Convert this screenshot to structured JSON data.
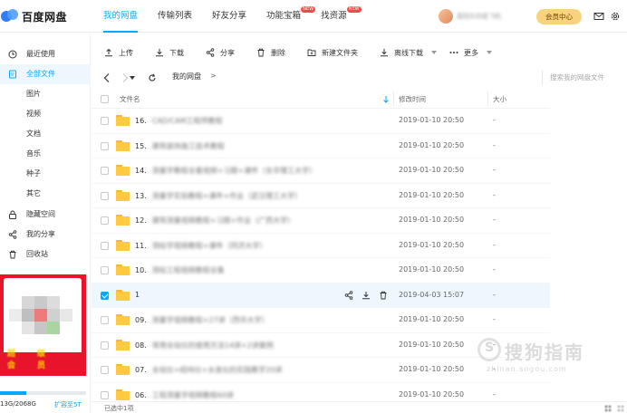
{
  "app": {
    "logo_text": "百度网盘"
  },
  "nav": [
    {
      "label": "我的网盘",
      "active": true,
      "badge": ""
    },
    {
      "label": "传输列表",
      "active": false,
      "badge": ""
    },
    {
      "label": "好友分享",
      "active": false,
      "badge": ""
    },
    {
      "label": "功能宝箱",
      "active": false,
      "badge": "NEW"
    },
    {
      "label": "找资源",
      "active": false,
      "badge": "NEW"
    }
  ],
  "user": {
    "name": "莫回头的纸飞机",
    "vip_label": "会员中心"
  },
  "sidebar": {
    "items": [
      {
        "label": "最近使用",
        "icon": "clock-icon"
      },
      {
        "label": "全部文件",
        "icon": "file-icon",
        "active": true
      },
      {
        "label": "隐藏空间",
        "icon": "lock-icon"
      },
      {
        "label": "我的分享",
        "icon": "share-icon"
      },
      {
        "label": "回收站",
        "icon": "trash-icon"
      }
    ],
    "sub_items": [
      "图片",
      "视频",
      "文档",
      "音乐",
      "种子",
      "其它"
    ],
    "promo_text": "超级会员",
    "quota_text": "13G/2068G",
    "quota_fraction": 0.31,
    "expand_label": "扩容至5T"
  },
  "toolbar": {
    "upload": "上传",
    "download": "下载",
    "share": "分享",
    "delete": "删除",
    "new_folder": "新建文件夹",
    "offline_download": "离线下载",
    "more": "更多"
  },
  "address": {
    "crumb": "我的网盘",
    "sep": ">",
    "search_placeholder": "搜索我的网盘文件"
  },
  "list": {
    "columns": {
      "name": "文件名",
      "time": "修改时间",
      "size": "大小"
    },
    "rows": [
      {
        "num": "16.",
        "name": "CAD/CAM工程师教程",
        "time": "2019-01-10 20:50",
        "size": "-",
        "selected": false
      },
      {
        "num": "15.",
        "name": "建筑装饰施工技术教程",
        "time": "2019-01-10 20:50",
        "size": "-",
        "selected": false
      },
      {
        "num": "14.",
        "name": "测量学教程全套视频+习题+课件（东华理工大学）",
        "time": "2019-01-10 20:50",
        "size": "-",
        "selected": false
      },
      {
        "num": "13.",
        "name": "测量学实验教程+课件+作业（武汉理工大学）",
        "time": "2019-01-10 20:50",
        "size": "-",
        "selected": false
      },
      {
        "num": "12.",
        "name": "建筑测量视频教程+习题+作业（广西大学）",
        "time": "2019-01-10 20:50",
        "size": "-",
        "selected": false
      },
      {
        "num": "11.",
        "name": "测绘学视频教程+课件（同济大学）",
        "time": "2019-01-10 20:50",
        "size": "-",
        "selected": false
      },
      {
        "num": "10.",
        "name": "测绘工程视频教程全集",
        "time": "2019-01-10 20:50",
        "size": "-",
        "selected": false
      },
      {
        "num": "1",
        "name": "",
        "time": "2019-04-03 15:07",
        "size": "-",
        "selected": true
      },
      {
        "num": "09.",
        "name": "测量学视频教程+27讲（西华大学）",
        "time": "2019-01-10 20:50",
        "size": "-",
        "selected": false
      },
      {
        "num": "08.",
        "name": "常用全站仪的使用方法14讲+2讲案例",
        "time": "2019-01-10 20:50",
        "size": "-",
        "selected": false
      },
      {
        "num": "07.",
        "name": "全站仪+经纬仪+水准仪的实践教学20讲",
        "time": "2019-01-10 20:50",
        "size": "-",
        "selected": false
      },
      {
        "num": "06.",
        "name": "工程测量学视频教程60讲",
        "time": "2019-01-10 20:50",
        "size": "-",
        "selected": false
      }
    ]
  },
  "status": {
    "text": "已选中1项"
  },
  "watermark": {
    "text": "搜狗指南",
    "url": "zhinan.sogou.com",
    "mark": "S"
  }
}
